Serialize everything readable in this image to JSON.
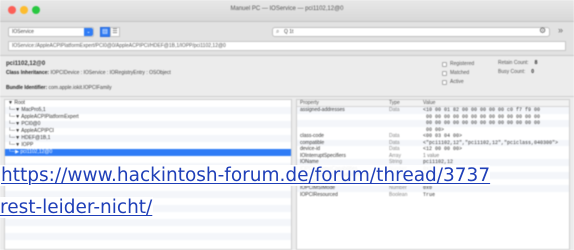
{
  "window": {
    "title": "Manuel PC — IOService — pci1102,12@0"
  },
  "toolbar": {
    "plane": "IOService",
    "search_value": "Q 1t",
    "path": "IOService:/AppleACPIPlatformExpert/PCI0@0/AppleACPIPCI/HDEF@1B,1/IOPP/pci1102,12@0"
  },
  "info": {
    "object_name": "pci1102,12@0",
    "class_label": "Class Inheritance:",
    "class_chain": "IOPCIDevice : IOService : IORegistryEntry : OSObject",
    "bundle_label": "Bundle Identifier:",
    "bundle_value": "com.apple.iokit.IOPCIFamily",
    "flags": [
      "Registered",
      "Matched",
      "Active"
    ],
    "counts": [
      {
        "label": "Retain Count:",
        "value": "8"
      },
      {
        "label": "Busy Count:",
        "value": "0"
      }
    ]
  },
  "tree": [
    "▼ Root",
    "└─▼ MacPro5,1",
    "   └─▼ AppleACPIPlatformExpert",
    "      └─▼ PCI0@0",
    "         └─▼ AppleACPIPCI",
    "            └─▼ HDEF@1B,1",
    "               └─▼ IOPP",
    "                  └─▶ pci1102,12@0",
    "",
    "",
    "",
    "",
    "",
    "",
    "",
    "",
    "",
    "",
    "",
    ""
  ],
  "tree_selected_index": 7,
  "props": {
    "headers": [
      "Property",
      "Type",
      "Value"
    ],
    "rows": [
      {
        "name": "",
        "type": "",
        "value": ""
      },
      {
        "name": "assigned-addresses",
        "type": "Data",
        "value": "<10 00 01 82 00 00 00 00 00 c0 f7 f9 00"
      },
      {
        "name": "",
        "type": "",
        "value": " 00 00 00 00 00 00 00 00 00 00 00 00 00"
      },
      {
        "name": "",
        "type": "",
        "value": " 00 00 00 00 00 00 00 00 00 00 00 00 00"
      },
      {
        "name": "",
        "type": "",
        "value": " 00 00>"
      },
      {
        "name": "",
        "type": "",
        "value": ""
      },
      {
        "name": "class-code",
        "type": "Data",
        "value": "<00 03 04 00>"
      },
      {
        "name": "compatible",
        "type": "Data",
        "value": "<\"pci1102,12\",\"pci1102,12\",\"pciclass,040300\">"
      },
      {
        "name": "device-id",
        "type": "Data",
        "value": "<12 00 00 00>"
      },
      {
        "name": "",
        "type": "",
        "value": ""
      },
      {
        "name": "",
        "type": "",
        "value": ""
      },
      {
        "name": "",
        "type": "",
        "value": ""
      },
      {
        "name": "",
        "type": "",
        "value": ""
      },
      {
        "name": "",
        "type": "",
        "value": ""
      },
      {
        "name": "",
        "type": "",
        "value": ""
      },
      {
        "name": "",
        "type": "",
        "value": ""
      },
      {
        "name": "IOInterruptSpecifiers",
        "type": "Array",
        "value": "1 value"
      },
      {
        "name": "IOName",
        "type": "String",
        "value": "pci1102,12"
      },
      {
        "name": "IOPCIExpressCapabilities",
        "type": "Number",
        "value": "0x2"
      },
      {
        "name": "IOPCIExpressLinkCapabilities",
        "type": "Number",
        "value": "0x33c11"
      },
      {
        "name": "IOPCIExpressLinkStatus",
        "type": "Number",
        "value": "0x1011"
      },
      {
        "name": "IOPCIMSIMode",
        "type": "Number",
        "value": "0x0"
      },
      {
        "name": "IOPCIResourced",
        "type": "Boolean",
        "value": "True"
      }
    ]
  },
  "caption": {
    "line1": "https://www.hackintosh-forum.de/forum/thread/3737",
    "line2": "rest-leider-nicht/"
  }
}
